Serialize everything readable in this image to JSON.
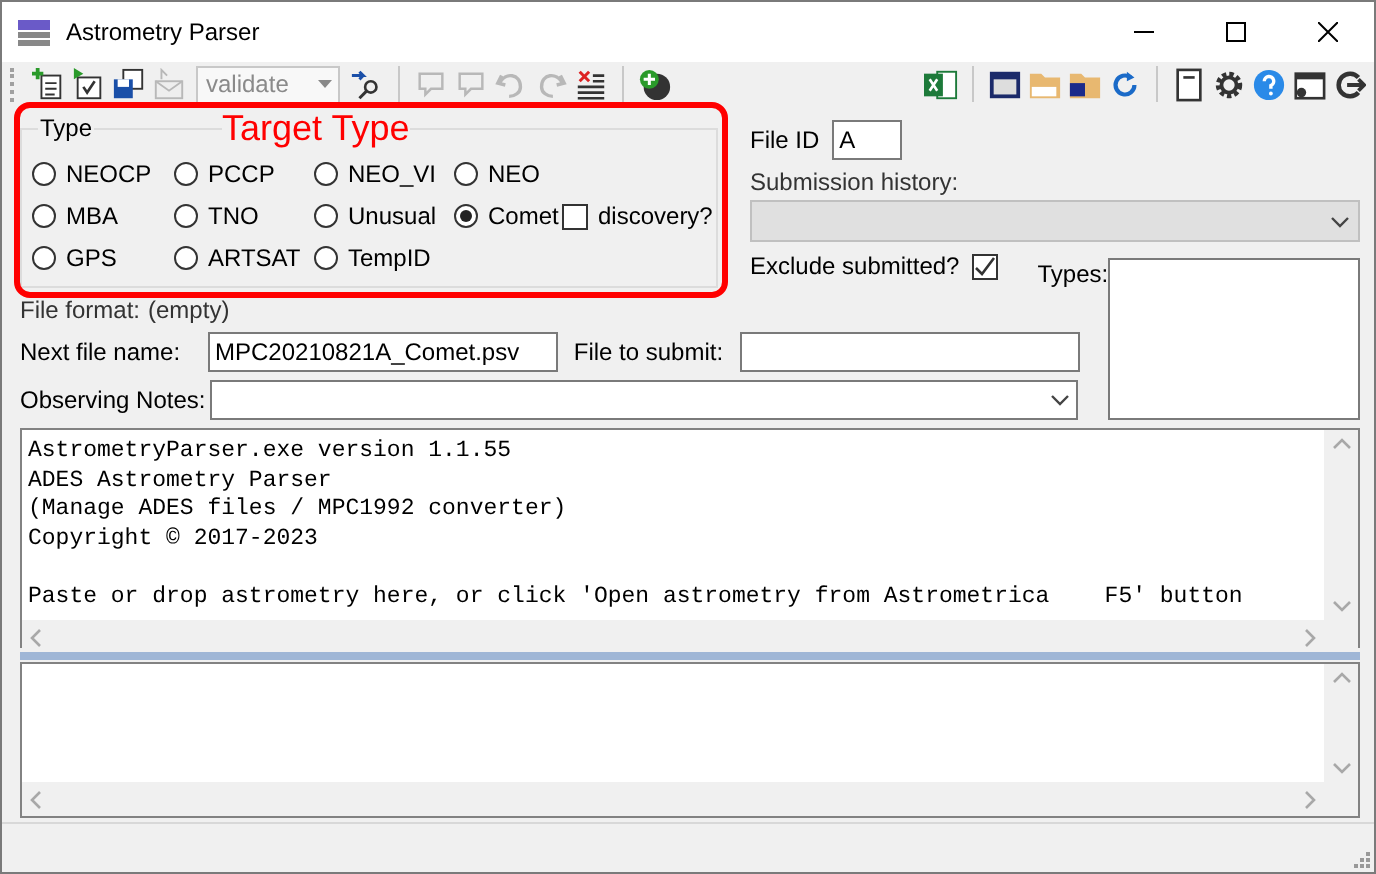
{
  "window": {
    "title": "Astrometry Parser"
  },
  "toolbar": {
    "lead": [
      {
        "kind": "new",
        "disabled": false
      },
      {
        "kind": "check",
        "disabled": false
      },
      {
        "kind": "save",
        "disabled": false
      },
      {
        "kind": "mail",
        "disabled": true
      }
    ],
    "combo": {
      "value": "validate",
      "disabled": true
    },
    "groups": [
      [
        {
          "kind": "find",
          "disabled": false
        }
      ],
      [
        {
          "kind": "comment",
          "disabled": true
        },
        {
          "kind": "comment",
          "disabled": true
        },
        {
          "kind": "undo",
          "disabled": true
        },
        {
          "kind": "redo",
          "disabled": true
        },
        {
          "kind": "delete",
          "disabled": false
        }
      ],
      [
        {
          "kind": "add",
          "disabled": false
        }
      ]
    ],
    "right_groups": [
      [
        {
          "kind": "excel",
          "disabled": false
        }
      ],
      [
        {
          "kind": "screen",
          "disabled": false
        },
        {
          "kind": "mpc",
          "disabled": false
        },
        {
          "kind": "folder",
          "disabled": false
        },
        {
          "kind": "refresh",
          "disabled": false
        }
      ],
      [
        {
          "kind": "page",
          "disabled": false
        },
        {
          "kind": "gear",
          "disabled": false
        },
        {
          "kind": "help",
          "disabled": false
        },
        {
          "kind": "window",
          "disabled": false
        },
        {
          "kind": "exit",
          "disabled": false
        }
      ]
    ]
  },
  "type_group": {
    "legend": "Type",
    "annotation": "Target Type",
    "options": [
      {
        "label": "NEOCP",
        "selected": false
      },
      {
        "label": "PCCP",
        "selected": false
      },
      {
        "label": "NEO_VI",
        "selected": false
      },
      {
        "label": "NEO",
        "selected": false
      },
      {
        "label": "MBA",
        "selected": false
      },
      {
        "label": "TNO",
        "selected": false
      },
      {
        "label": "Unusual",
        "selected": false
      },
      {
        "label": "Comet",
        "selected": true
      },
      {
        "label": "GPS",
        "selected": false
      },
      {
        "label": "ARTSAT",
        "selected": false
      },
      {
        "label": "TempID",
        "selected": false
      }
    ],
    "discovery": {
      "label": "discovery?",
      "checked": false
    }
  },
  "file_id": {
    "label": "File ID",
    "value": "A"
  },
  "submission_history": {
    "label": "Submission history:"
  },
  "exclude_submitted": {
    "label": "Exclude submitted?",
    "checked": true
  },
  "types": {
    "label": "Types:"
  },
  "file_format": {
    "label": "File format:",
    "value": "(empty)"
  },
  "next_file_name": {
    "label": "Next file name:",
    "value": "MPC20210821A_Comet.psv"
  },
  "file_to_submit": {
    "label": "File to submit:"
  },
  "observing_notes": {
    "label": "Observing Notes:"
  },
  "log": {
    "lines": [
      "AstrometryParser.exe version 1.1.55",
      "ADES Astrometry Parser",
      "(Manage ADES files / MPC1992 converter)",
      "Copyright © 2017-2023"
    ],
    "prompt": "Paste or drop astrometry here, or click 'Open astrometry from Astrometrica    F5' button"
  }
}
